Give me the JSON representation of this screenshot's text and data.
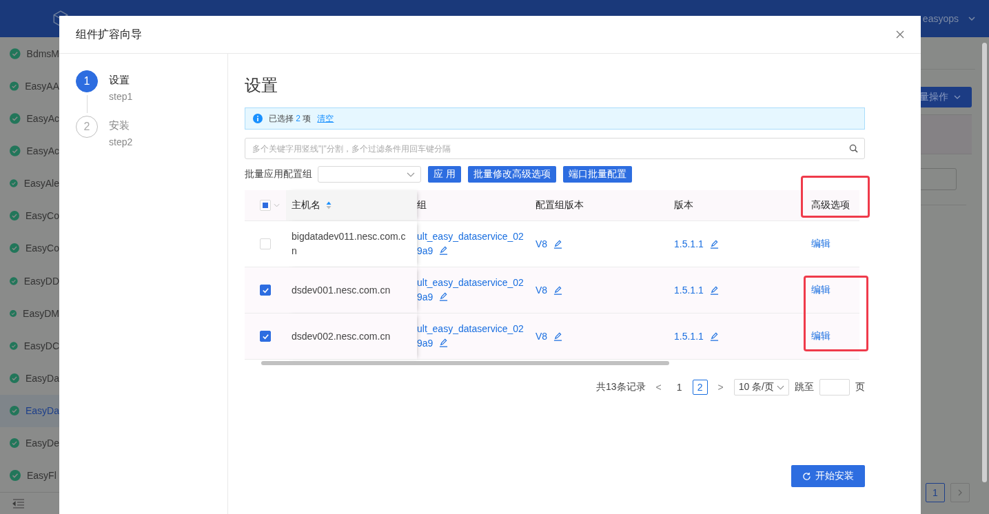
{
  "top_bar": {
    "user": "easyops"
  },
  "sidebar": {
    "items": [
      {
        "label": "BdmsM",
        "selected": false
      },
      {
        "label": "EasyAA",
        "selected": false
      },
      {
        "label": "EasyAc",
        "selected": false
      },
      {
        "label": "EasyAc",
        "selected": false
      },
      {
        "label": "EasyAle",
        "selected": false
      },
      {
        "label": "EasyCo",
        "selected": false
      },
      {
        "label": "EasyCo",
        "selected": false
      },
      {
        "label": "EasyDD",
        "selected": false
      },
      {
        "label": "EasyDM",
        "selected": false
      },
      {
        "label": "EasyDC",
        "selected": false
      },
      {
        "label": "EasyDa",
        "selected": false
      },
      {
        "label": "EasyDa",
        "selected": true
      },
      {
        "label": "EasyDe",
        "selected": false
      },
      {
        "label": "EasyFl",
        "selected": false
      }
    ]
  },
  "background_panel": {
    "button": "量操作",
    "pages": [
      {
        "label": "1",
        "selected": true
      }
    ]
  },
  "dialog": {
    "title": "组件扩容向导",
    "steps": [
      {
        "number": "1",
        "title": "设置",
        "subtitle": "step1",
        "active": true
      },
      {
        "number": "2",
        "title": "安装",
        "subtitle": "step2",
        "active": false
      }
    ],
    "heading": "设置",
    "alert": {
      "prefix": "已选择",
      "count": "2",
      "suffix": "项",
      "link": "清空"
    },
    "search": {
      "placeholder": "多个关键字用竖线\"|\"分割，多个过滤条件用回车键分隔"
    },
    "batch": {
      "label": "批量应用配置组",
      "buttons": [
        "应 用",
        "批量修改高级选项",
        "端口批量配置"
      ]
    },
    "table": {
      "select_all_indeterminate": true,
      "columns": [
        {
          "label": "主机名",
          "sorted_ascending": true,
          "highlighted": false
        },
        {
          "label": "组",
          "highlighted": false
        },
        {
          "label": "配置组版本",
          "highlighted": false
        },
        {
          "label": "版本",
          "highlighted": false
        },
        {
          "label": "高级选项",
          "highlighted": true
        }
      ],
      "rows": [
        {
          "selected": false,
          "host": "bigdatadev011.nesc.com.cn",
          "group": "ult_easy_dataservice_029a9",
          "config_version": "V8",
          "version": "1.5.1.1",
          "action": "编辑",
          "action_highlighted": false
        },
        {
          "selected": true,
          "host": "dsdev001.nesc.com.cn",
          "group": "ult_easy_dataservice_029a9",
          "config_version": "V8",
          "version": "1.5.1.1",
          "action": "编辑",
          "action_highlighted": true
        },
        {
          "selected": true,
          "host": "dsdev002.nesc.com.cn",
          "group": "ult_easy_dataservice_029a9",
          "config_version": "V8",
          "version": "1.5.1.1",
          "action": "编辑",
          "action_highlighted": true
        }
      ]
    },
    "pagination": {
      "total": "共13条记录",
      "prev": "<",
      "next": ">",
      "pages": [
        {
          "label": "1",
          "selected": false
        },
        {
          "label": "2",
          "selected": true
        }
      ],
      "page_size": "10 条/页",
      "jump_label": "跳至",
      "page_unit": "页"
    },
    "footer_button": "开始安装"
  }
}
